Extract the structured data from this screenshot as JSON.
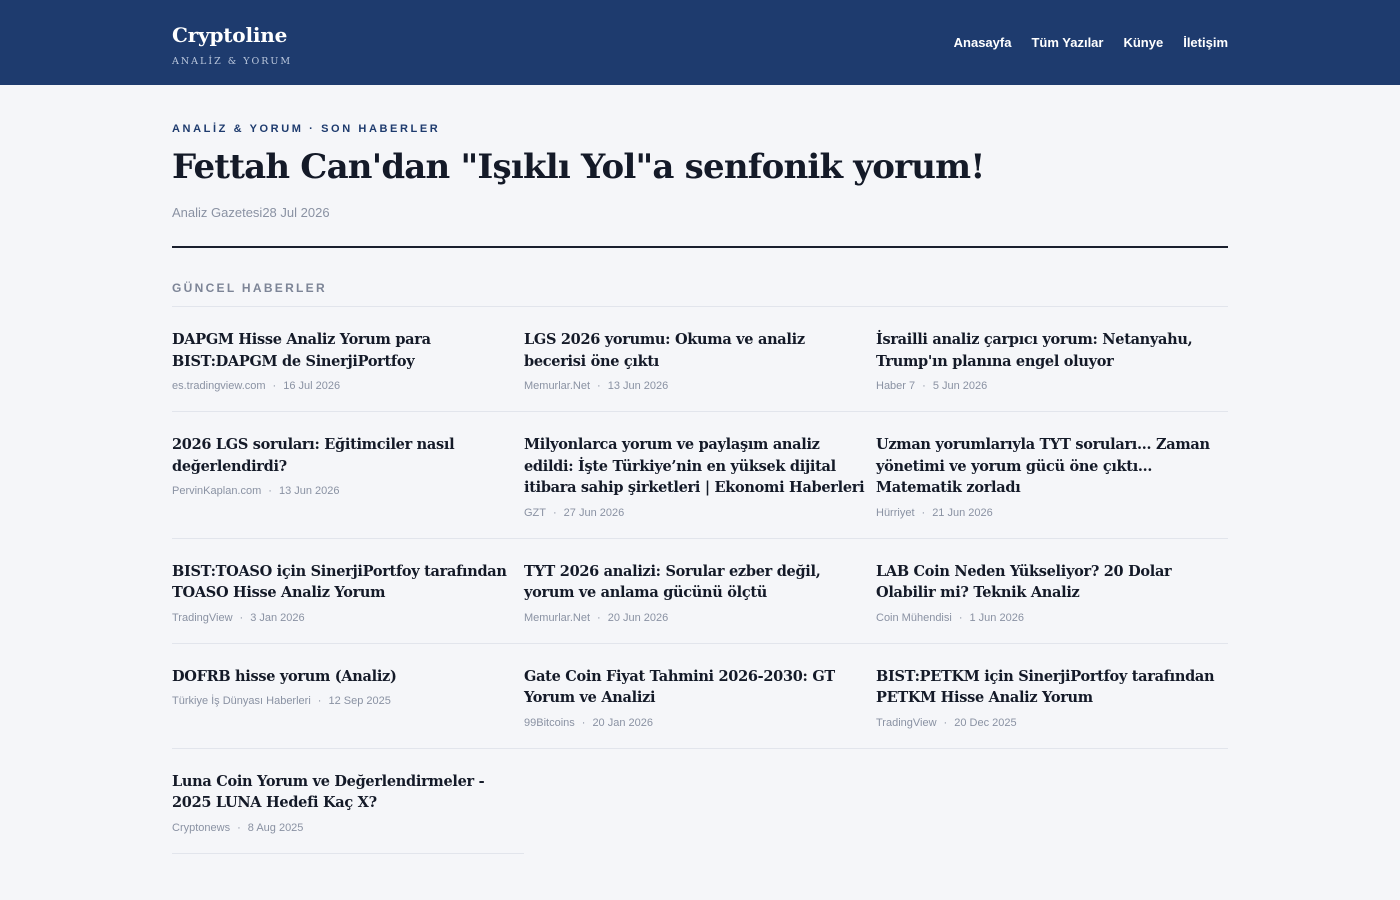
{
  "header": {
    "brand": "Cryptoline",
    "tagline": "ANALİZ & YORUM",
    "nav": [
      "Anasayfa",
      "Tüm Yazılar",
      "Künye",
      "İletişim"
    ]
  },
  "article": {
    "kicker": "ANALİZ & YORUM · SON HABERLER",
    "title": "Fettah Can'dan \"Işıklı Yol\"a senfonik yorum!",
    "meta": "Analiz Gazetesi28 Jul 2026"
  },
  "news": {
    "section_title": "GÜNCEL HABERLER",
    "items": [
      {
        "title": "DAPGM Hisse Analiz Yorum para BIST:DAPGM de SinerjiPortfoy",
        "source": "es.tradingview.com",
        "date": "16 Jul 2026"
      },
      {
        "title": "LGS 2026 yorumu: Okuma ve analiz becerisi öne çıktı",
        "source": "Memurlar.Net",
        "date": "13 Jun 2026"
      },
      {
        "title": "İsrailli analiz çarpıcı yorum: Netanyahu, Trump'ın planına engel oluyor",
        "source": "Haber 7",
        "date": "5 Jun 2026"
      },
      {
        "title": "2026 LGS soruları: Eğitimciler nasıl değerlendirdi?",
        "source": "PervinKaplan.com",
        "date": "13 Jun 2026"
      },
      {
        "title": "Milyonlarca yorum ve paylaşım analiz edildi: İşte Türkiye’nin en yüksek dijital itibara sahip şirketleri | Ekonomi Haberleri",
        "source": "GZT",
        "date": "27 Jun 2026"
      },
      {
        "title": "Uzman yorumlarıyla TYT soruları… Zaman yönetimi ve yorum gücü öne çıktı… Matematik zorladı",
        "source": "Hürriyet",
        "date": "21 Jun 2026"
      },
      {
        "title": "BIST:TOASO için SinerjiPortfoy tarafından TOASO Hisse Analiz Yorum",
        "source": "TradingView",
        "date": "3 Jan 2026"
      },
      {
        "title": "TYT 2026 analizi: Sorular ezber değil, yorum ve anlama gücünü ölçtü",
        "source": "Memurlar.Net",
        "date": "20 Jun 2026"
      },
      {
        "title": "LAB Coin Neden Yükseliyor? 20 Dolar Olabilir mi? Teknik Analiz",
        "source": "Coin Mühendisi",
        "date": "1 Jun 2026"
      },
      {
        "title": "DOFRB hisse yorum (Analiz)",
        "source": "Türkiye İş Dünyası Haberleri",
        "date": "12 Sep 2025"
      },
      {
        "title": "Gate Coin Fiyat Tahmini 2026-2030: GT Yorum ve Analizi",
        "source": "99Bitcoins",
        "date": "20 Jan 2026"
      },
      {
        "title": "BIST:PETKM için SinerjiPortfoy tarafından PETKM Hisse Analiz Yorum",
        "source": "TradingView",
        "date": "20 Dec 2025"
      },
      {
        "title": "Luna Coin Yorum ve Değerlendirmeler - 2025 LUNA Hedefi Kaç X?",
        "source": "Cryptonews",
        "date": "8 Aug 2025"
      }
    ]
  }
}
